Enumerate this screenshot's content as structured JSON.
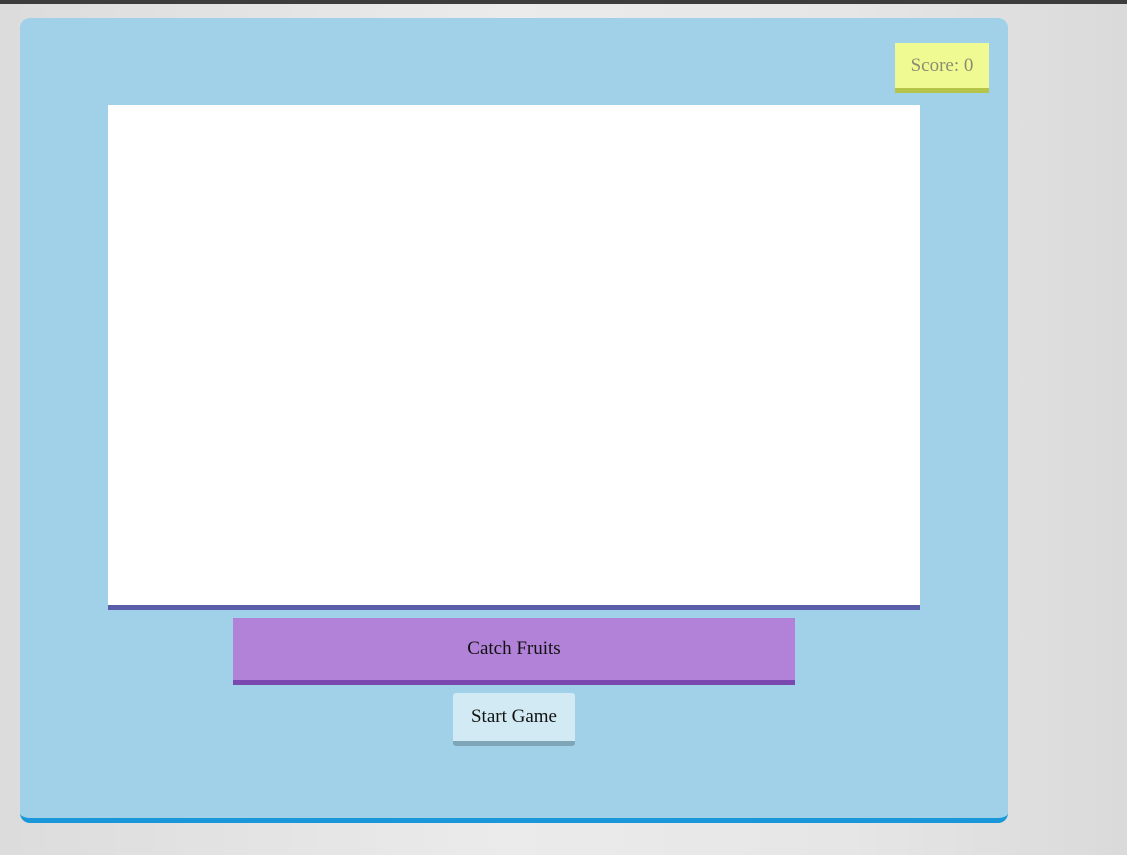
{
  "score": {
    "label": "Score: 0",
    "value": 0
  },
  "game": {
    "title": "Catch Fruits"
  },
  "controls": {
    "start_label": "Start Game"
  },
  "colors": {
    "panel_background": "#a0d1e8",
    "panel_border": "#1a97d8",
    "score_background": "#f0fa92",
    "title_background": "#b282d8",
    "start_button_background": "#d2eaf4",
    "play_area_background": "#ffffff",
    "play_area_border": "#5a5ea8"
  }
}
